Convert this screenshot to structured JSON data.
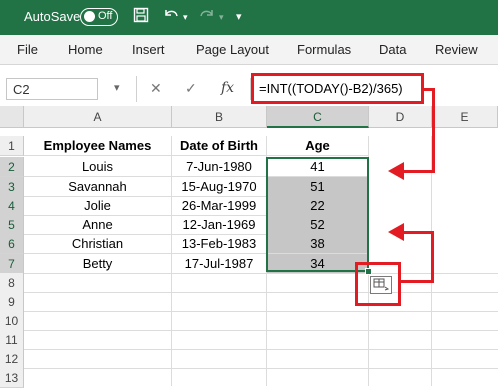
{
  "titlebar": {
    "autosave_label": "AutoSave",
    "toggle_state": "Off",
    "icons": [
      "save-icon",
      "undo-icon",
      "redo-icon",
      "customize-qat-icon"
    ]
  },
  "ribbon": {
    "tabs": [
      "File",
      "Home",
      "Insert",
      "Page Layout",
      "Formulas",
      "Data",
      "Review"
    ]
  },
  "formula_bar": {
    "name_box": "C2",
    "cancel_symbol": "✕",
    "enter_symbol": "✓",
    "fx_symbol": "fx",
    "formula": "=INT((TODAY()-B2)/365)"
  },
  "sheet": {
    "column_headers": [
      "A",
      "B",
      "C",
      "D",
      "E"
    ],
    "row_numbers": [
      "1",
      "2",
      "3",
      "4",
      "5",
      "6",
      "7",
      "8",
      "9",
      "10",
      "11",
      "12",
      "13"
    ],
    "table_headers": [
      "Employee Names",
      "Date of Birth",
      "Age"
    ],
    "rows": [
      {
        "name": "Louis",
        "dob": "7-Jun-1980",
        "age": "41"
      },
      {
        "name": "Savannah",
        "dob": "15-Aug-1970",
        "age": "51"
      },
      {
        "name": "Jolie",
        "dob": "26-Mar-1999",
        "age": "22"
      },
      {
        "name": "Anne",
        "dob": "12-Jan-1969",
        "age": "52"
      },
      {
        "name": "Christian",
        "dob": "13-Feb-1983",
        "age": "38"
      },
      {
        "name": "Betty",
        "dob": "17-Jul-1987",
        "age": "34"
      }
    ]
  },
  "colors": {
    "excel_green": "#217346",
    "annotation_red": "#e31b23",
    "selected_fill": "#c6c6c6"
  }
}
